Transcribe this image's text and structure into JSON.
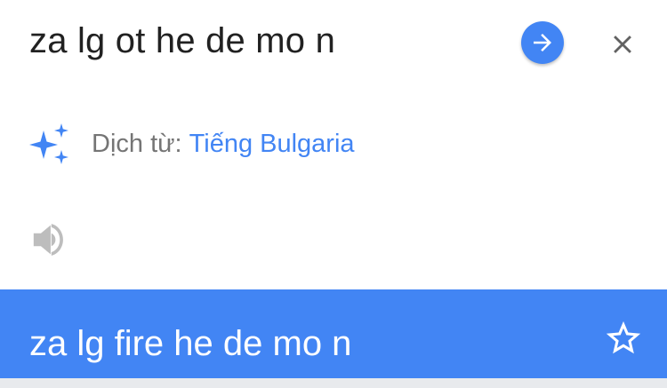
{
  "input": {
    "source_text": "za lg ot he de mo n",
    "go_icon": "arrow-right-icon",
    "close_icon": "close-icon"
  },
  "detection": {
    "icon": "sparkle-icon",
    "label": "Dịch từ:",
    "language": "Tiếng Bulgaria"
  },
  "speaker": {
    "icon": "speaker-icon"
  },
  "result": {
    "translated_text": "za lg fire he de mo n",
    "star_icon": "star-outline-icon"
  },
  "colors": {
    "accent": "#4285f4",
    "text_primary": "#212121",
    "text_secondary": "#757575",
    "icon_gray": "#bdbdbd"
  }
}
